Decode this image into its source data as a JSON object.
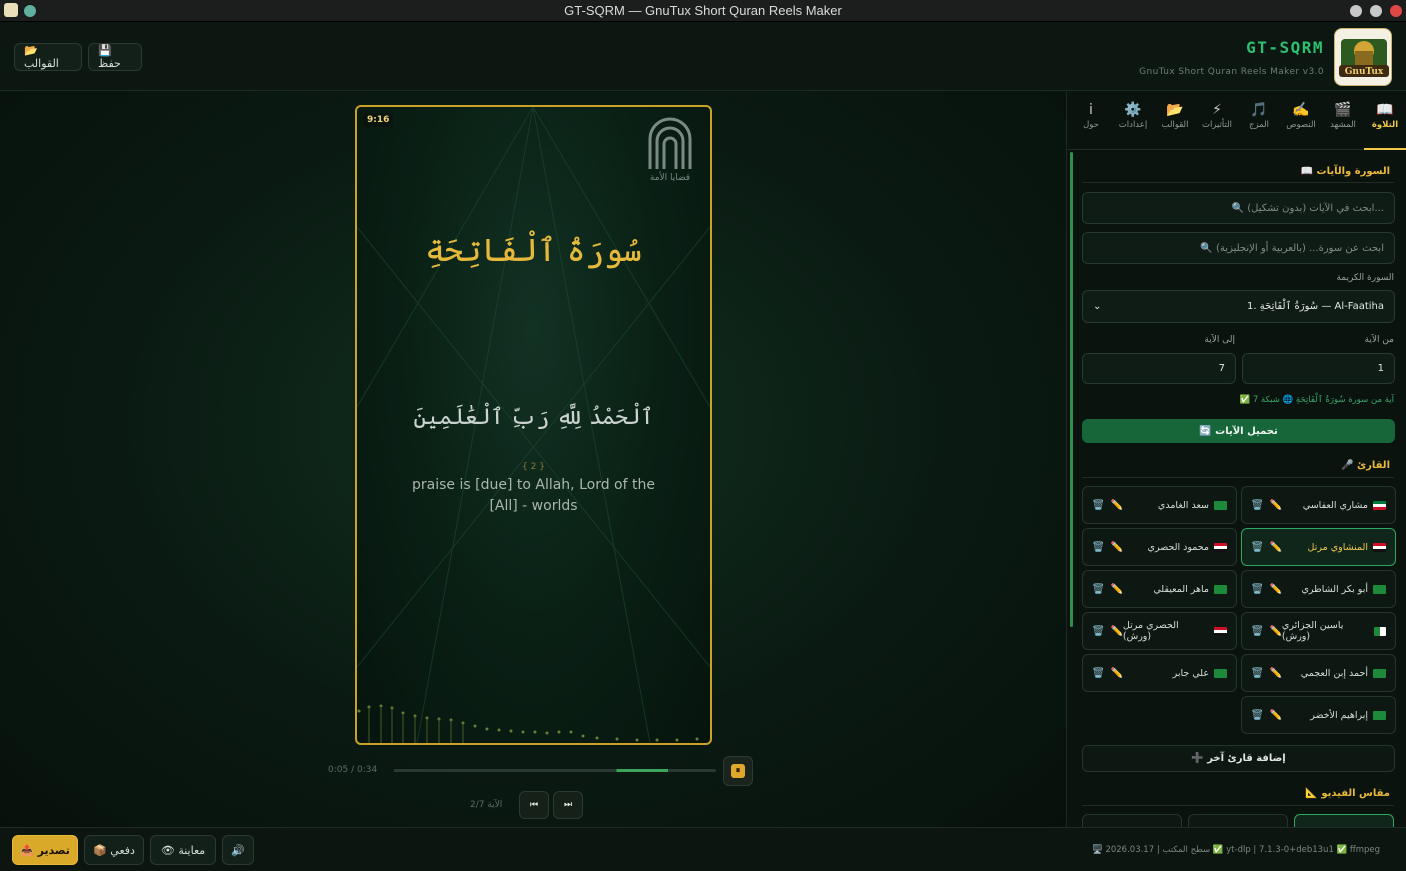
{
  "window": {
    "title": "GT-SQRM — GnuTux Short Quran Reels Maker"
  },
  "header": {
    "brand": "GT-SQRM",
    "subtitle": "GnuTux Short Quran Reels Maker v3.0",
    "logo_text": "GnuTux",
    "templates_btn": "📂 القوالب",
    "save_btn": "💾 حفظ"
  },
  "preview": {
    "ratio_badge": "9:16",
    "surah_title": "سُورَةُ ٱلْفَاتِحَةِ",
    "ayah_text": "ٱلْحَمْدُ لِلَّهِ رَبِّ ٱلْعَٰلَمِينَ",
    "verse_number": "{ 2 }",
    "translation": "praise is [due] to Allah, Lord of the [All] - worlds",
    "watermark": "قضايا الأمة",
    "time": "0:05 / 0:34",
    "progress": 0.85,
    "ayah_counter": "الآية 2/7",
    "pause_icon": "⏸",
    "prev_icon": "⏮",
    "next_icon": "⏭"
  },
  "tabs": [
    {
      "icon": "📖",
      "label": "التلاوة",
      "active": true
    },
    {
      "icon": "🎬",
      "label": "المشهد",
      "active": false
    },
    {
      "icon": "✍️",
      "label": "النصوص",
      "active": false
    },
    {
      "icon": "🎵",
      "label": "المزج",
      "active": false
    },
    {
      "icon": "⚡",
      "label": "التأثيرات",
      "active": false
    },
    {
      "icon": "📂",
      "label": "القوالب",
      "active": false
    },
    {
      "icon": "⚙️",
      "label": "إعدادات",
      "active": false
    },
    {
      "icon": "i",
      "label": "حول",
      "active": false
    }
  ],
  "recitation": {
    "section_title": "📖 السورة والآيات",
    "ayah_search_placeholder": "🔍 ابحث في الآيات (بدون تشكيل)...",
    "surah_search_placeholder": "🔍 ابحث عن سورة... (بالعربية أو الإنجليزية)",
    "surah_label": "السورة الكريمة",
    "surah_selected": "1. سُورَةُ ٱلْفَاتِحَةِ — Al-Faatiha",
    "from_label": "من الآية",
    "to_label": "إلى الآية",
    "from_value": "1",
    "to_value": "7",
    "status": "✅ 7 آية من سورة سُورَةُ ٱلْفَاتِحَةِ 🌐 شبكة",
    "load_btn": "🔄 تحميل الآيات"
  },
  "reciters": {
    "section_title": "🎤 القارئ",
    "items": [
      {
        "name": "مشاري العفاسي",
        "flag": "kw",
        "selected": false
      },
      {
        "name": "سعد الغامدي",
        "flag": "sa",
        "selected": false
      },
      {
        "name": "المنشاوي مرتل",
        "flag": "eg",
        "selected": true
      },
      {
        "name": "محمود الحصري",
        "flag": "eg",
        "selected": false
      },
      {
        "name": "أبو بكر الشاطري",
        "flag": "sa",
        "selected": false
      },
      {
        "name": "ماهر المعيقلي",
        "flag": "sa",
        "selected": false
      },
      {
        "name": "ياسين الجزائري (ورش)",
        "flag": "dz",
        "selected": false
      },
      {
        "name": "الحصري مرتل (ورش)",
        "flag": "eg",
        "selected": false
      },
      {
        "name": "أحمد إبن العجمي",
        "flag": "sa",
        "selected": false
      },
      {
        "name": "علي جابر",
        "flag": "sa",
        "selected": false
      },
      {
        "name": "إبراهيم الأخضر",
        "flag": "sa",
        "selected": false
      }
    ],
    "edit_icon": "✏️",
    "delete_icon": "🗑️",
    "add_btn": "➕ إضافة قارئ آخر"
  },
  "video_ratio": {
    "section_title": "📐 مقاس الفيديو"
  },
  "footer": {
    "export_btn": "📤 تصدير",
    "batch_btn": "📦 دفعي",
    "preview_btn": "👁 معاينة",
    "sound_icon": "🔊",
    "system_info": "🖥️ سطح المكتب | 2026.03.17 ✅ yt-dlp | 7.1.3-0+deb13u1 ✅ ffmpeg"
  },
  "colors": {
    "accent": "#e9b93c",
    "brand": "#2fbf71",
    "selected_border": "#2fa862",
    "export": "#d9a92a"
  }
}
